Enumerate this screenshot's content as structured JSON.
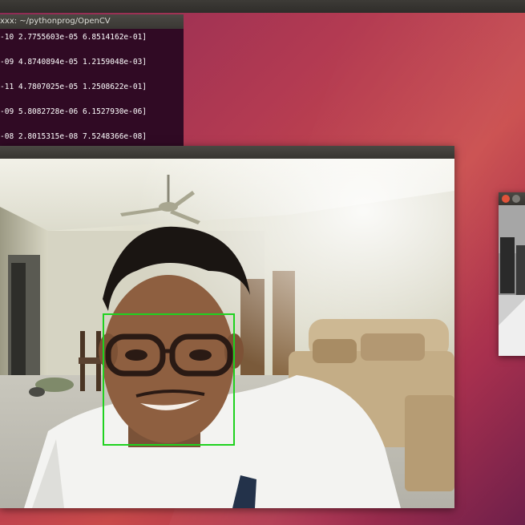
{
  "desktop": {
    "background": "#b23a52"
  },
  "terminal": {
    "title": "xxx: ~/pythonprog/OpenCV",
    "lines": [
      "-10 2.7755603e-05 6.8514162e-01]",
      "-09 4.8740894e-05 1.2159048e-03]",
      "-11 4.7807025e-05 1.2508622e-01]",
      "-09 5.8082728e-06 6.1527930e-06]",
      "-08 2.8015315e-08 7.5248366e-08]"
    ]
  },
  "camera_window": {
    "detection_color": "#1fd21f"
  },
  "gray_window": {
    "close_icon": "close-icon",
    "minimize_icon": "minimize-icon"
  }
}
